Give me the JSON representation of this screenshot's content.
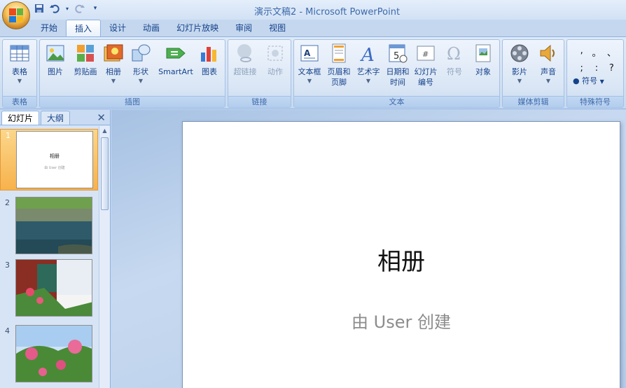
{
  "app": {
    "title": "演示文稿2 - Microsoft PowerPoint"
  },
  "quick_access": {
    "icons": [
      "save-icon",
      "undo-icon",
      "redo-icon",
      "customize-icon"
    ]
  },
  "tabs": [
    "开始",
    "插入",
    "设计",
    "动画",
    "幻灯片放映",
    "审阅",
    "视图"
  ],
  "active_tab": "插入",
  "ribbon": {
    "groups": {
      "table": "表格",
      "illustrations": "插图",
      "links": "链接",
      "text": "文本",
      "media": "媒体剪辑",
      "symbols": "特殊符号"
    },
    "buttons": {
      "table": "表格",
      "picture": "图片",
      "clipart": "剪贴画",
      "album": "相册",
      "shapes": "形状",
      "smartart": "SmartArt",
      "chart": "图表",
      "hyperlink": "超链接",
      "action": "动作",
      "textbox": "文本框",
      "header_l1": "页眉和",
      "header_l2": "页脚",
      "wordart": "艺术字",
      "datetime_l1": "日期和",
      "datetime_l2": "时间",
      "slidenum_l1": "幻灯片",
      "slidenum_l2": "编号",
      "symbol": "符号",
      "object": "对象",
      "movie": "影片",
      "sound": "声音",
      "special_symbol": "符号"
    },
    "symbol_grid": [
      ",",
      "。",
      "、",
      ";",
      ":",
      "?"
    ]
  },
  "panel": {
    "tab_slides": "幻灯片",
    "tab_outline": "大纲",
    "slides": [
      {
        "num": "1",
        "title": "相册",
        "subtitle": "由 User 创建"
      },
      {
        "num": "2"
      },
      {
        "num": "3"
      },
      {
        "num": "4"
      }
    ]
  },
  "slide": {
    "title": "相册",
    "subtitle": "由 User 创建"
  }
}
